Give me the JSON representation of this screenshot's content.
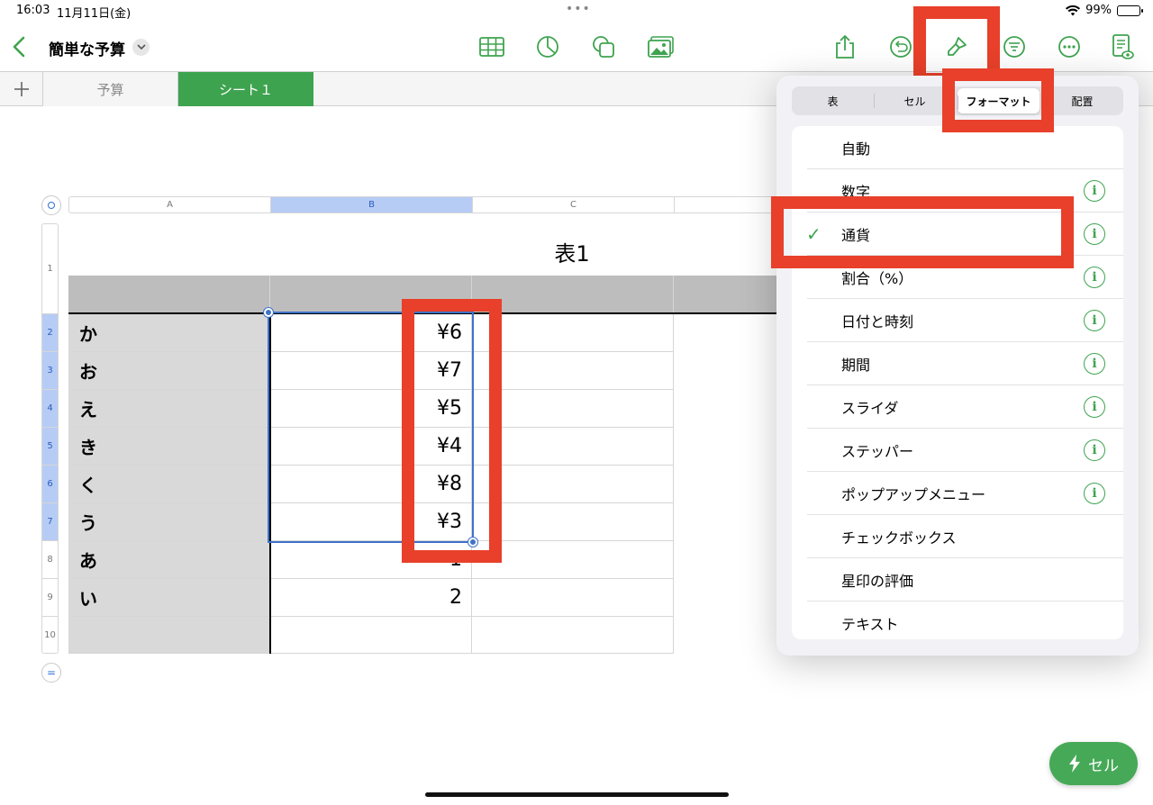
{
  "status_bar": {
    "time": "16:03",
    "date": "11月11日(金)",
    "battery": "99%"
  },
  "toolbar": {
    "doc_title": "簡単な予算"
  },
  "sheet_tabs": [
    {
      "label": "予算"
    },
    {
      "label": "シート１"
    }
  ],
  "table": {
    "title": "表1",
    "columns": [
      "A",
      "B",
      "C"
    ],
    "row_numbers": [
      "1",
      "2",
      "3",
      "4",
      "5",
      "6",
      "7",
      "8",
      "9",
      "10"
    ],
    "rows": [
      {
        "label": "か",
        "value": "¥6"
      },
      {
        "label": "お",
        "value": "¥7"
      },
      {
        "label": "え",
        "value": "¥5"
      },
      {
        "label": "き",
        "value": "¥4"
      },
      {
        "label": "く",
        "value": "¥8"
      },
      {
        "label": "う",
        "value": "¥3"
      },
      {
        "label": "あ",
        "value": "1"
      },
      {
        "label": "い",
        "value": "2"
      }
    ]
  },
  "format_panel": {
    "segments": [
      "表",
      "セル",
      "フォーマット",
      "配置"
    ],
    "active_segment": "フォーマット",
    "items": [
      {
        "label": "自動",
        "info": false,
        "checked": false
      },
      {
        "label": "数字",
        "info": true,
        "checked": false
      },
      {
        "label": "通貨",
        "info": true,
        "checked": true
      },
      {
        "label": "割合（%）",
        "info": true,
        "checked": false
      },
      {
        "label": "日付と時刻",
        "info": true,
        "checked": false
      },
      {
        "label": "期間",
        "info": true,
        "checked": false
      },
      {
        "label": "スライダ",
        "info": true,
        "checked": false
      },
      {
        "label": "ステッパー",
        "info": true,
        "checked": false
      },
      {
        "label": "ポップアップメニュー",
        "info": true,
        "checked": false
      },
      {
        "label": "チェックボックス",
        "info": false,
        "checked": false
      },
      {
        "label": "星印の評価",
        "info": false,
        "checked": false
      },
      {
        "label": "テキスト",
        "info": false,
        "checked": false
      }
    ]
  },
  "fab": {
    "label": "セル"
  },
  "colors": {
    "accent": "#3ea34f",
    "annotation": "#e8402a",
    "selection": "#3f72c8"
  }
}
